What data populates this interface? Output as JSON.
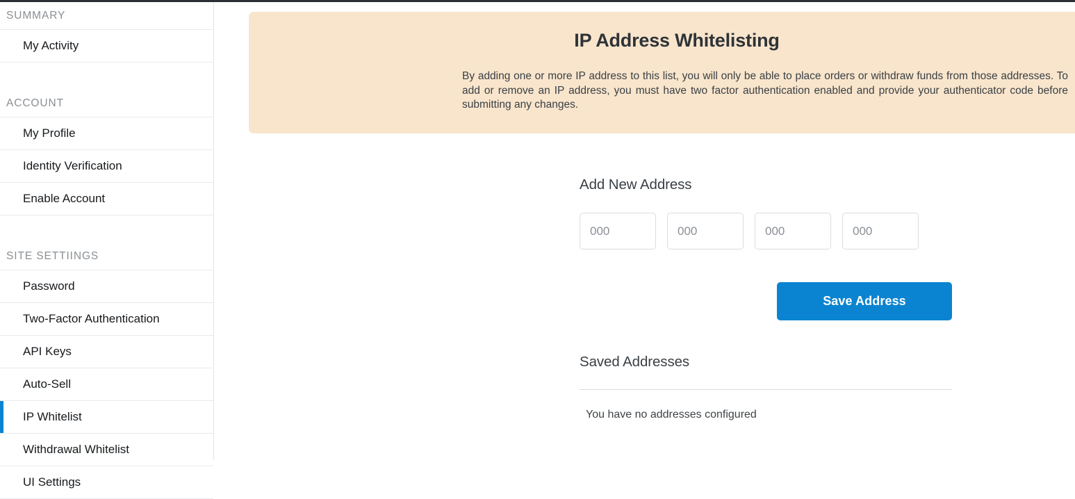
{
  "theme": {
    "accent_blue": "#0a84d0",
    "banner_bg": "#f8e5cc",
    "sidebar_border": "#e2e4e6",
    "muted_text": "#8a8f94"
  },
  "sidebar": {
    "sections": [
      {
        "title": "SUMMARY",
        "items": [
          {
            "label": "My Activity",
            "active": false
          }
        ]
      },
      {
        "title": "ACCOUNT",
        "items": [
          {
            "label": "My Profile",
            "active": false
          },
          {
            "label": "Identity Verification",
            "active": false
          },
          {
            "label": "Enable Account",
            "active": false
          }
        ]
      },
      {
        "title": "SITE SETTIINGS",
        "items": [
          {
            "label": "Password",
            "active": false
          },
          {
            "label": "Two-Factor Authentication",
            "active": false
          },
          {
            "label": "API Keys",
            "active": false
          },
          {
            "label": "Auto-Sell",
            "active": false
          },
          {
            "label": "IP Whitelist",
            "active": true
          },
          {
            "label": "Withdrawal Whitelist",
            "active": false
          },
          {
            "label": "UI Settings",
            "active": false
          }
        ]
      }
    ]
  },
  "banner": {
    "title": "IP Address Whitelisting",
    "description": "By adding one or more IP address to this list, you will only be able to place orders or withdraw funds from those addresses. To add or remove an IP address, you must have two factor authentication enabled and provide your authenticator code before submitting any changes."
  },
  "add_address": {
    "heading": "Add New Address",
    "octets": [
      {
        "value": "",
        "placeholder": "000"
      },
      {
        "value": "",
        "placeholder": "000"
      },
      {
        "value": "",
        "placeholder": "000"
      },
      {
        "value": "",
        "placeholder": "000"
      }
    ],
    "save_label": "Save Address"
  },
  "saved_addresses": {
    "heading": "Saved Addresses",
    "empty_message": "You have no addresses configured",
    "rows": []
  }
}
